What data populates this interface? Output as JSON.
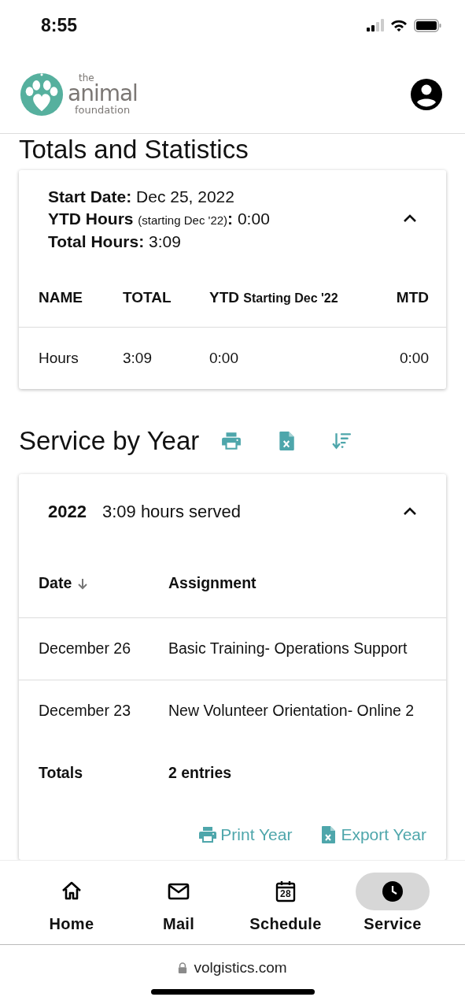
{
  "status_bar": {
    "time": "8:55"
  },
  "header": {
    "logo": {
      "line_1": "the",
      "line_2": "animal",
      "line_3": "foundation"
    }
  },
  "totals": {
    "title": "Totals and Statistics",
    "expanded": true,
    "summary": [
      {
        "label": "Start Date",
        "colon": ":",
        "value": "Dec 25, 2022"
      },
      {
        "label": "YTD Hours",
        "note": "(starting Dec '22)",
        "colon": ":",
        "value": "0:00"
      },
      {
        "label": "Total Hours",
        "colon": ":",
        "value": "3:09"
      }
    ],
    "columns": [
      {
        "label": "NAME"
      },
      {
        "label": "TOTAL"
      },
      {
        "label": "YTD",
        "note": "Starting Dec '22"
      },
      {
        "label": "MTD"
      }
    ],
    "rows": [
      [
        "Hours",
        "3:09",
        "0:00",
        "0:00"
      ]
    ]
  },
  "service": {
    "title": "Service by Year",
    "years": [
      {
        "year": "2022",
        "summary": "3:09 hours served",
        "expanded": true,
        "columns": [
          {
            "label": "Date",
            "sorted": true,
            "descending": true
          },
          {
            "label": "Assignment"
          }
        ],
        "rows": [
          [
            "December 26",
            "Basic Training- Operations Support"
          ],
          [
            "December 23",
            "New Volunteer Orientation- Online 2"
          ]
        ],
        "totals": {
          "label": "Totals",
          "value": "2 entries"
        },
        "actions": [
          {
            "kind": "print",
            "label": "Print Year"
          },
          {
            "kind": "export",
            "label": "Export Year"
          }
        ]
      }
    ]
  },
  "bottom_nav": [
    {
      "kind": "home",
      "label": "Home",
      "selected": false
    },
    {
      "kind": "mail",
      "label": "Mail",
      "selected": false
    },
    {
      "kind": "schedule",
      "label": "Schedule",
      "badge": "28",
      "selected": false
    },
    {
      "kind": "service",
      "label": "Service",
      "selected": true
    }
  ],
  "browser": {
    "url": "volgistics.com",
    "secure": true
  }
}
